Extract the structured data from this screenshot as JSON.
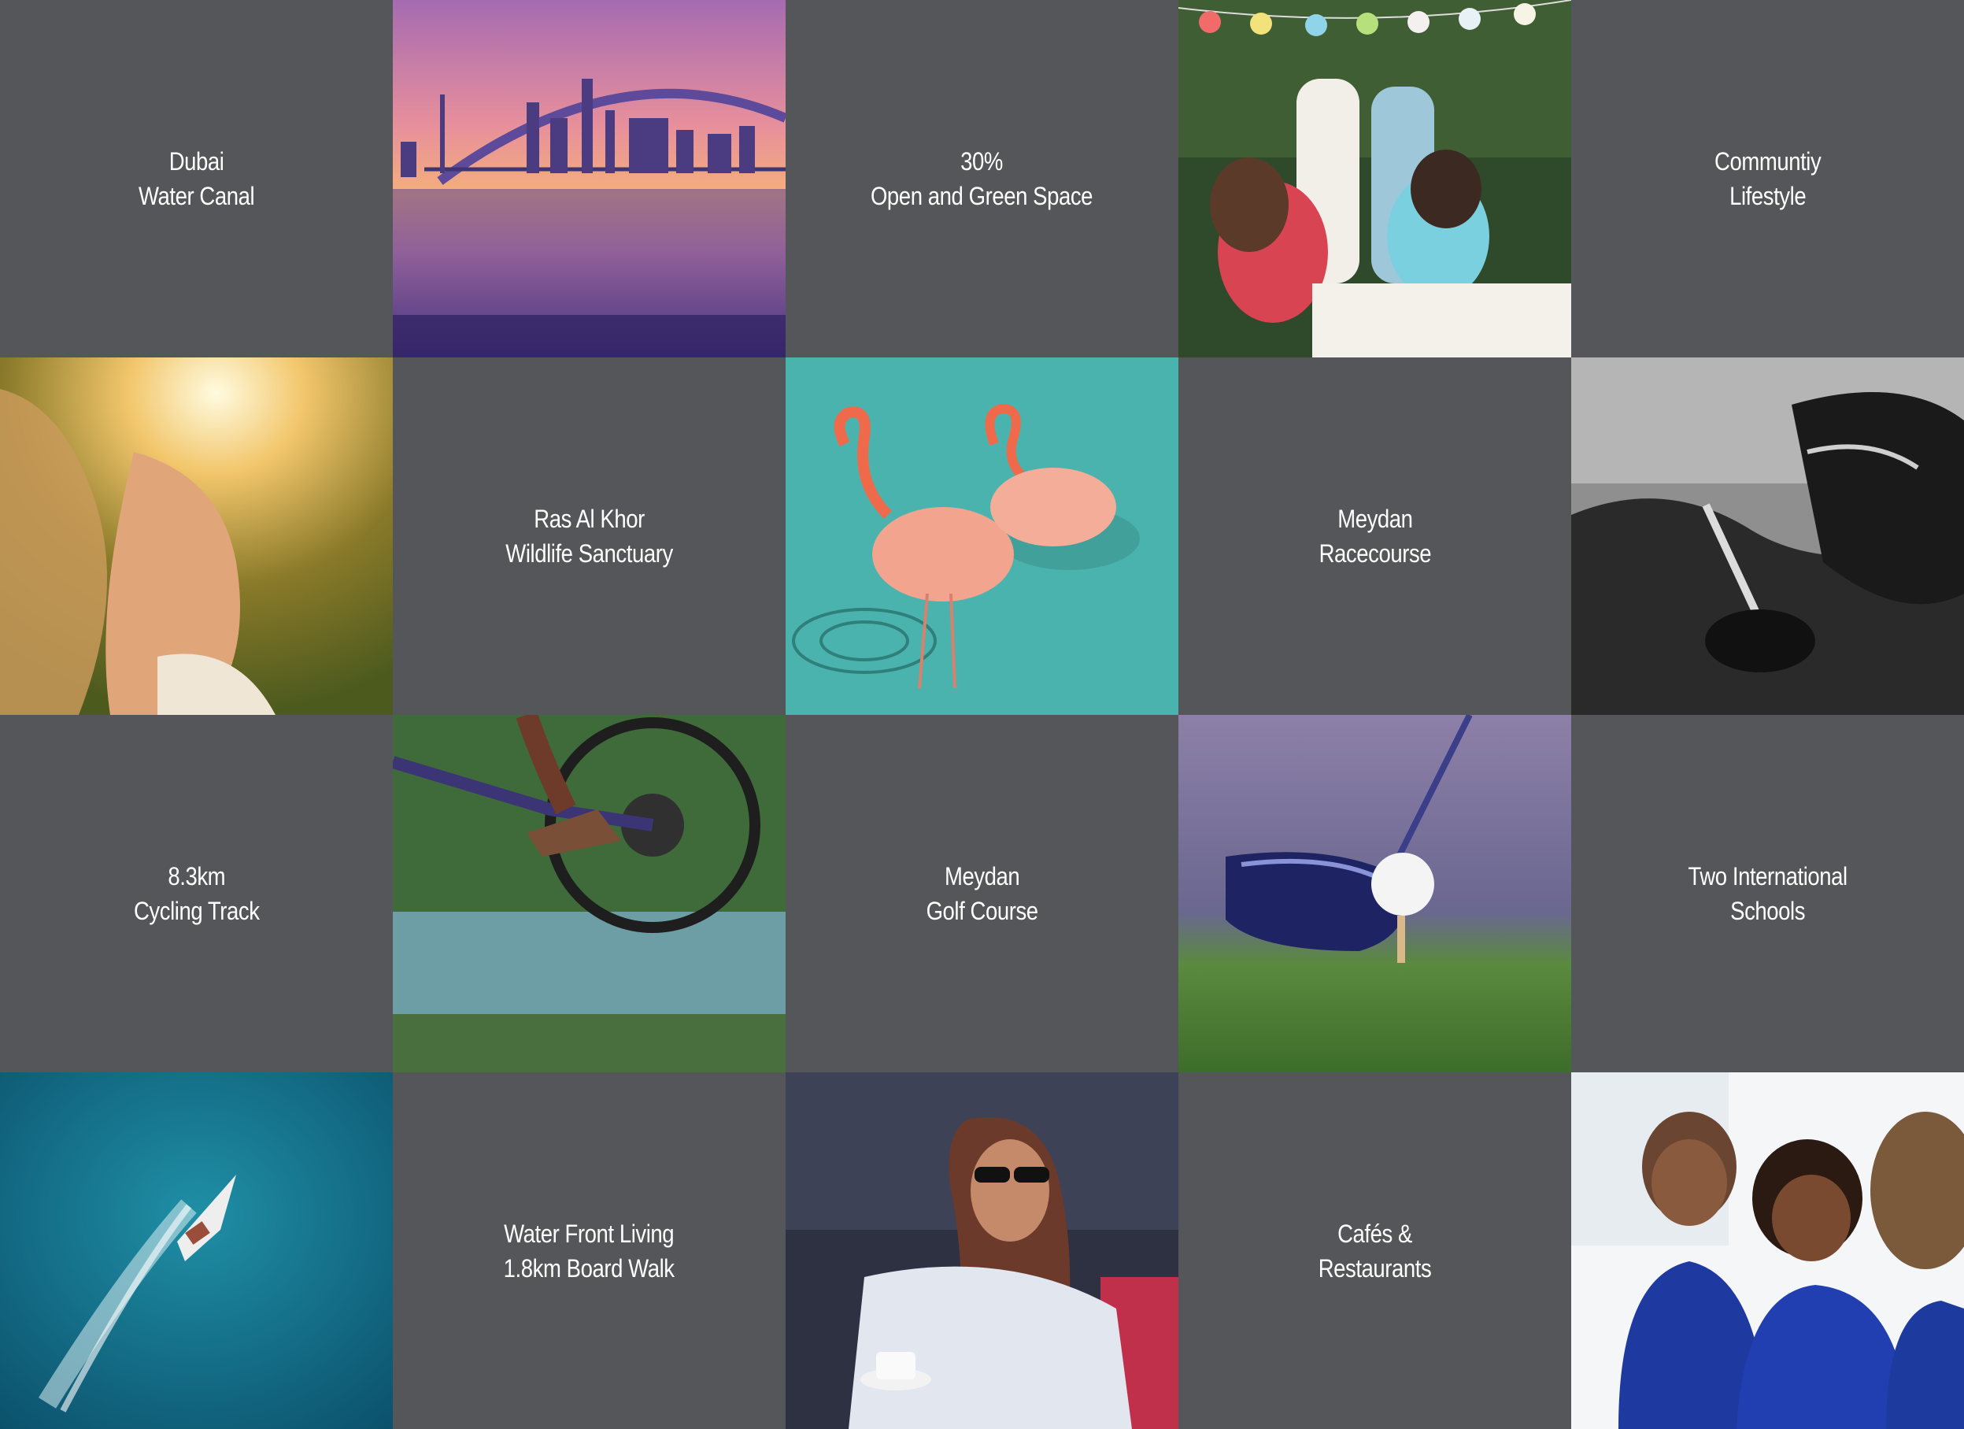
{
  "tiles": {
    "dubai_water_canal": {
      "line1": "Dubai",
      "line2": "Water Canal"
    },
    "open_green_space": {
      "line1": "30%",
      "line2": "Open and Green Space"
    },
    "community_lifestyle": {
      "line1": "Communtiy",
      "line2": "Lifestyle"
    },
    "ras_al_khor": {
      "line1": "Ras Al Khor",
      "line2": "Wildlife Sanctuary"
    },
    "meydan_racecourse": {
      "line1": "Meydan",
      "line2": "Racecourse"
    },
    "cycling_track": {
      "line1": "8.3km",
      "line2": "Cycling Track"
    },
    "meydan_golf": {
      "line1": "Meydan",
      "line2": "Golf Course"
    },
    "international_schools": {
      "line1": "Two International",
      "line2": "Schools"
    },
    "water_front": {
      "line1": "Water Front Living",
      "line2": "1.8km Board Walk"
    },
    "cafes": {
      "line1": "Cafés &",
      "line2": "Restaurants"
    }
  },
  "colors": {
    "tile_background": "#55565a",
    "text": "#ffffff"
  }
}
